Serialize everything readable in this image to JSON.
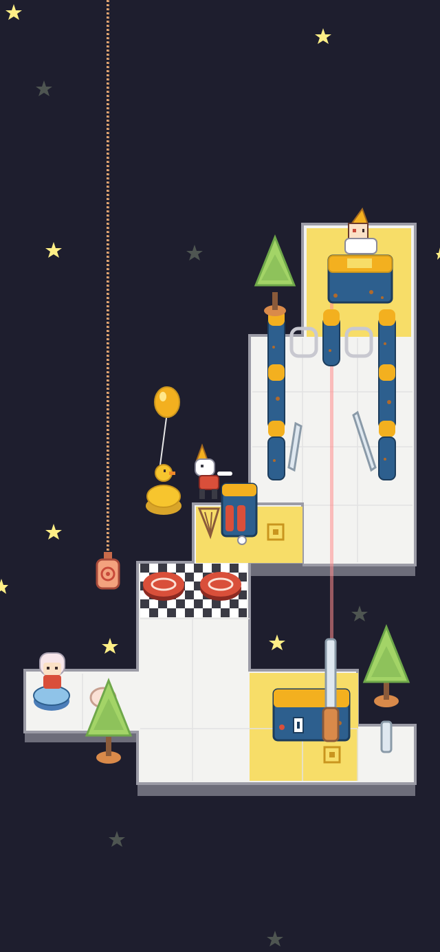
{
  "screen": {
    "background": "#1e1e2e",
    "has_visible_text": false
  },
  "palette": {
    "floor": "#f3f3f1",
    "floor_grid": "#e2e2e2",
    "floor_outline": "#9b9ba6",
    "floor_side": "#6d6d7a",
    "yellow_tile": "#f7dd68",
    "yellow_mark": "#c9951e",
    "pillar": "#2d5f8e",
    "pillar_cap": "#f3b01f",
    "rust": "#b06a2c",
    "tree": "#a3d467",
    "tree_dark": "#6fa84a",
    "pot": "#d98a4a",
    "red_button": "#d94f3a",
    "laser": "#ff8d8d",
    "star_bright": "#ffef86",
    "star_dim": "#4e5551",
    "rope": "#e6ab77"
  },
  "entities": {
    "player": "white-haired-girl-on-blue-pad",
    "npc_top": "cone-hat-kid-on-machine",
    "npc_mid": "white-creature-with-party-hat",
    "duck": "yellow-rubber-duck",
    "balloon": "yellow-balloon",
    "rope_item": "hanging-sack",
    "trees": 3,
    "pressure_buttons": 2,
    "mirrors": 4
  }
}
